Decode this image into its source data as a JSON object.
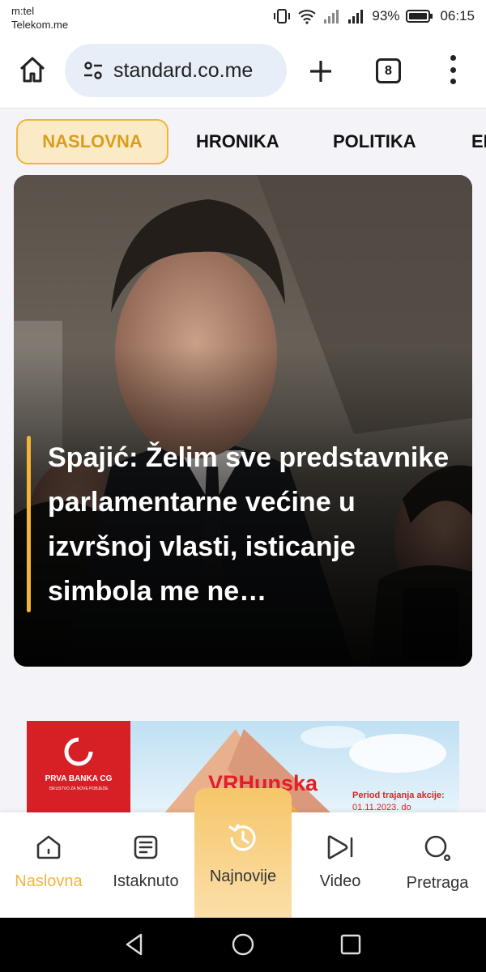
{
  "status_bar": {
    "carrier_line1": "m:tel",
    "carrier_line2": "Telekom.me",
    "battery": "93%",
    "time": "06:15"
  },
  "browser": {
    "url": "standard.co.me",
    "tab_count": "8"
  },
  "categories": [
    {
      "label": "NASLOVNA",
      "active": true
    },
    {
      "label": "HRONIKA",
      "active": false
    },
    {
      "label": "POLITIKA",
      "active": false
    },
    {
      "label": "EKONOMIJA",
      "active": false
    }
  ],
  "hero": {
    "title": "Spajić: Želim sve predstavnike parlamentarne većine u izvršnoj vlasti, isticanje simbola me ne…",
    "accent_color": "#f3b535"
  },
  "ad": {
    "bank_name": "PRVA BANKA CG",
    "tagline": "ISKUSTVO ZA NOVE POBJEDE",
    "headline": "VRHunska",
    "period_label": "Period trajanja akcije:",
    "period_date": "01.11.2023. do"
  },
  "bottom_nav": [
    {
      "label": "Naslovna",
      "icon": "home-icon",
      "selected": true
    },
    {
      "label": "Istaknuto",
      "icon": "article-icon",
      "selected": false
    },
    {
      "label": "Najnovije",
      "icon": "history-icon",
      "selected": false
    },
    {
      "label": "Video",
      "icon": "video-icon",
      "selected": false
    },
    {
      "label": "Pretraga",
      "icon": "search-icon",
      "selected": false
    }
  ],
  "colors": {
    "accent": "#f0b43c",
    "accent_bg": "#faebc6"
  }
}
